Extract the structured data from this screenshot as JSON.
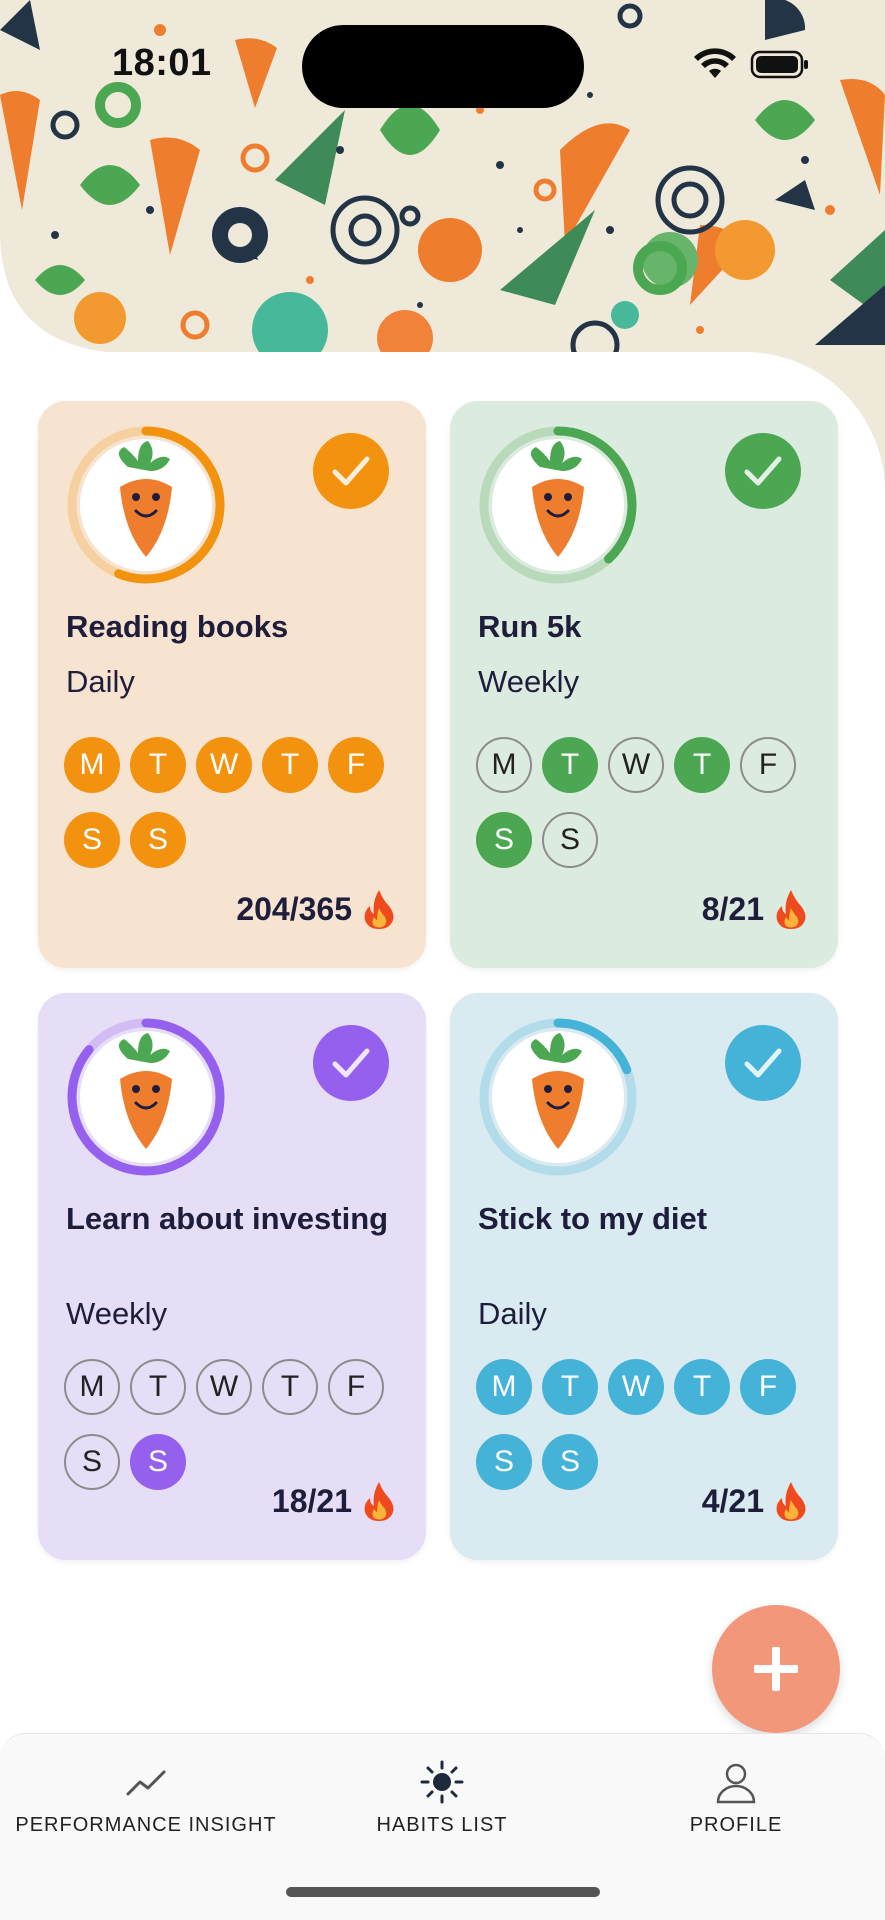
{
  "status_bar": {
    "time": "18:01"
  },
  "habits": [
    {
      "title": "Reading books",
      "frequency": "Daily",
      "days": [
        {
          "letter": "M",
          "active": true
        },
        {
          "letter": "T",
          "active": true
        },
        {
          "letter": "W",
          "active": true
        },
        {
          "letter": "T",
          "active": true
        },
        {
          "letter": "F",
          "active": true
        },
        {
          "letter": "S",
          "active": true
        },
        {
          "letter": "S",
          "active": true
        }
      ],
      "streak": "204/365",
      "progress": 0.56,
      "completed": true,
      "accent": "#f2920f",
      "card_color": "#f7e4d0",
      "avatar_icon": "carrot-laptop-icon"
    },
    {
      "title": "Run 5k",
      "frequency": "Weekly",
      "days": [
        {
          "letter": "M",
          "active": false
        },
        {
          "letter": "T",
          "active": true
        },
        {
          "letter": "W",
          "active": false
        },
        {
          "letter": "T",
          "active": true
        },
        {
          "letter": "F",
          "active": false
        },
        {
          "letter": "S",
          "active": true
        },
        {
          "letter": "S",
          "active": false
        }
      ],
      "streak": "8/21",
      "progress": 0.38,
      "completed": true,
      "accent": "#4ba751",
      "card_color": "#dcebdf",
      "avatar_icon": "carrot-running-icon"
    },
    {
      "title": "Learn about investing",
      "frequency": "Weekly",
      "days": [
        {
          "letter": "M",
          "active": false
        },
        {
          "letter": "T",
          "active": false
        },
        {
          "letter": "W",
          "active": false
        },
        {
          "letter": "T",
          "active": false
        },
        {
          "letter": "F",
          "active": false
        },
        {
          "letter": "S",
          "active": false
        },
        {
          "letter": "S",
          "active": true
        }
      ],
      "streak": "18/21",
      "progress": 0.86,
      "completed": true,
      "accent": "#9560ee",
      "card_color": "#e6ddf6",
      "avatar_icon": "carrot-money-icon"
    },
    {
      "title": "Stick to my diet",
      "frequency": "Daily",
      "days": [
        {
          "letter": "M",
          "active": true
        },
        {
          "letter": "T",
          "active": true
        },
        {
          "letter": "W",
          "active": true
        },
        {
          "letter": "T",
          "active": true
        },
        {
          "letter": "F",
          "active": true
        },
        {
          "letter": "S",
          "active": true
        },
        {
          "letter": "S",
          "active": true
        }
      ],
      "streak": "4/21",
      "progress": 0.19,
      "completed": true,
      "accent": "#45b3d8",
      "card_color": "#d9eaf0",
      "avatar_icon": "carrot-meditating-icon"
    }
  ],
  "fab": {
    "icon": "plus-icon"
  },
  "nav": {
    "items": [
      {
        "label": "PERFORMANCE INSIGHT",
        "icon": "chart-line-icon"
      },
      {
        "label": "HABITS LIST",
        "icon": "sun-icon"
      },
      {
        "label": "PROFILE",
        "icon": "person-icon"
      }
    ]
  }
}
